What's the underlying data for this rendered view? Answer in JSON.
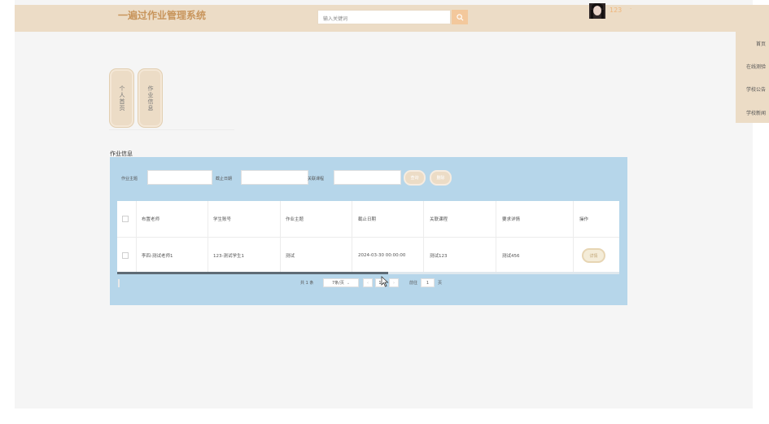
{
  "header": {
    "brand": "一遍过作业管理系统",
    "search_placeholder": "输入关键词",
    "username": "123",
    "user_caret": "·"
  },
  "sidenav": {
    "items": [
      "首页",
      "在线测验",
      "学校公告",
      "学校新闻"
    ]
  },
  "vertical_buttons": [
    {
      "label": "个人首页"
    },
    {
      "label": "作业信息"
    }
  ],
  "section_title": "作业信息",
  "filters": {
    "subject_label": "作业主题",
    "deadline_label": "截止日期",
    "course_label": "关联课程",
    "search_button": "查询",
    "delete_button": "删除"
  },
  "table": {
    "columns": [
      "布置老师",
      "学生账号",
      "作业主题",
      "截止日期",
      "关联课程",
      "要求详情",
      "操作"
    ],
    "rows": [
      {
        "teacher": "李四-测试老师1",
        "student": "123-测试学生1",
        "subject": "测试",
        "deadline": "2024-03-30 00:00:00",
        "course": "测试123",
        "requirements": "测试456",
        "action": "详情"
      }
    ]
  },
  "pagination": {
    "total": "共 1 条",
    "page_size": "7条/页",
    "current_page": "1",
    "prev": "‹",
    "next": "›",
    "goto_label": "前往",
    "goto_value": "1",
    "page_unit": "页"
  },
  "colors": {
    "topbar": "#ecdcc6",
    "brand": "#c8955c",
    "panel": "#b6d6ea",
    "accent": "#f3c89c"
  }
}
